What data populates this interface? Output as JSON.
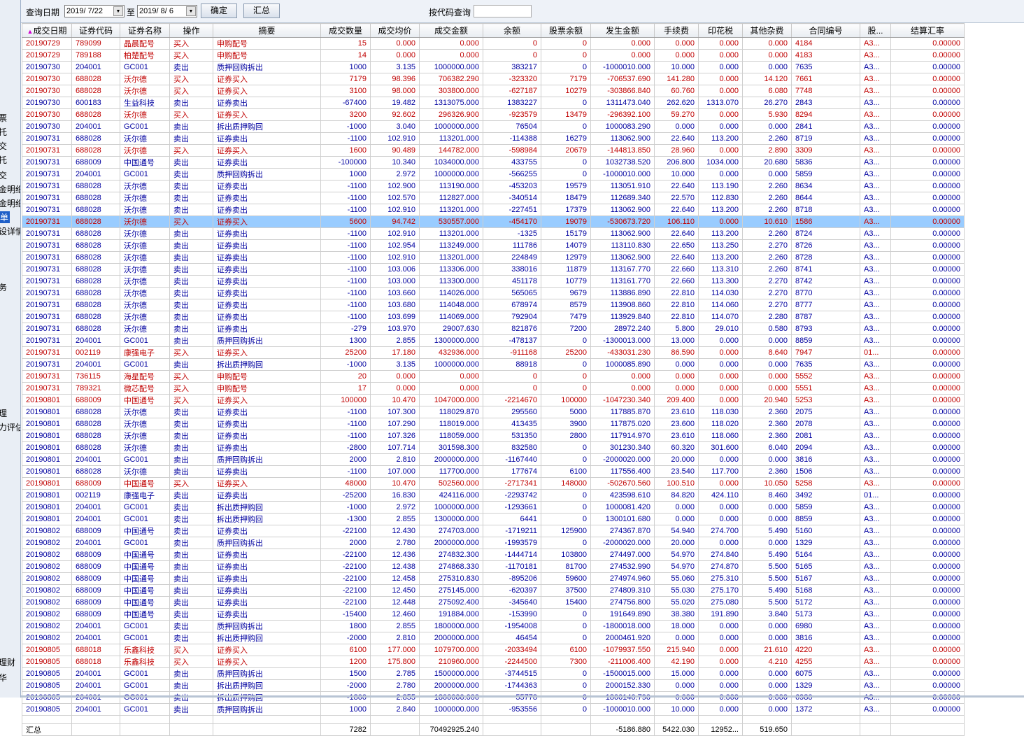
{
  "sidebar": {
    "fragments": [
      "票",
      "托",
      "交",
      "托",
      "交",
      "金明细",
      "金明细",
      "单",
      "设详情",
      "务",
      "理",
      "力评估",
      "理财",
      "华"
    ]
  },
  "toolbar": {
    "query_date_label": "查询日期",
    "date_from": "2019/ 7/22",
    "to_label": "至",
    "date_to": "2019/ 8/ 6",
    "confirm_label": "确定",
    "summary_label": "汇总",
    "code_query_label": "按代码查询",
    "code_query_value": ""
  },
  "columns": [
    "成交日期",
    "证券代码",
    "证券名称",
    "操作",
    "摘要",
    "成交数量",
    "成交均价",
    "成交金额",
    "余额",
    "股票余额",
    "发生金额",
    "手续费",
    "印花税",
    "其他杂费",
    "合同编号",
    "股...",
    "结算汇率"
  ],
  "sort_indicator": "▲",
  "selected_row": 15,
  "colors": {
    "buy": "#c00000",
    "sell": "#0000a0",
    "selected": "#99ccff"
  },
  "rows": [
    [
      "20190729",
      "789099",
      "晶晨配号",
      "买入",
      "申购配号",
      "15",
      "0.000",
      "0.000",
      "0",
      "0",
      "0.000",
      "0.000",
      "0.000",
      "0.000",
      "4184",
      "A3...",
      "0.00000"
    ],
    [
      "20190729",
      "789188",
      "柏楚配号",
      "买入",
      "申购配号",
      "14",
      "0.000",
      "0.000",
      "0",
      "0",
      "0.000",
      "0.000",
      "0.000",
      "0.000",
      "4183",
      "A3...",
      "0.00000"
    ],
    [
      "20190730",
      "204001",
      "GC001",
      "卖出",
      "质押回购拆出",
      "1000",
      "3.135",
      "1000000.000",
      "383217",
      "0",
      "-1000010.000",
      "10.000",
      "0.000",
      "0.000",
      "7635",
      "A3...",
      "0.00000"
    ],
    [
      "20190730",
      "688028",
      "沃尔德",
      "买入",
      "证券买入",
      "7179",
      "98.396",
      "706382.290",
      "-323320",
      "7179",
      "-706537.690",
      "141.280",
      "0.000",
      "14.120",
      "7661",
      "A3...",
      "0.00000"
    ],
    [
      "20190730",
      "688028",
      "沃尔德",
      "买入",
      "证券买入",
      "3100",
      "98.000",
      "303800.000",
      "-627187",
      "10279",
      "-303866.840",
      "60.760",
      "0.000",
      "6.080",
      "7748",
      "A3...",
      "0.00000"
    ],
    [
      "20190730",
      "600183",
      "生益科技",
      "卖出",
      "证券卖出",
      "-67400",
      "19.482",
      "1313075.000",
      "1383227",
      "0",
      "1311473.040",
      "262.620",
      "1313.070",
      "26.270",
      "2843",
      "A3...",
      "0.00000"
    ],
    [
      "20190730",
      "688028",
      "沃尔德",
      "买入",
      "证券买入",
      "3200",
      "92.602",
      "296326.900",
      "-923579",
      "13479",
      "-296392.100",
      "59.270",
      "0.000",
      "5.930",
      "8294",
      "A3...",
      "0.00000"
    ],
    [
      "20190730",
      "204001",
      "GC001",
      "卖出",
      "拆出质押购回",
      "-1000",
      "3.040",
      "1000000.000",
      "76504",
      "0",
      "1000083.290",
      "0.000",
      "0.000",
      "0.000",
      "2841",
      "A3...",
      "0.00000"
    ],
    [
      "20190731",
      "688028",
      "沃尔德",
      "卖出",
      "证券卖出",
      "-1100",
      "102.910",
      "113201.000",
      "-114388",
      "16279",
      "113062.900",
      "22.640",
      "113.200",
      "2.260",
      "8719",
      "A3...",
      "0.00000"
    ],
    [
      "20190731",
      "688028",
      "沃尔德",
      "买入",
      "证券买入",
      "1600",
      "90.489",
      "144782.000",
      "-598984",
      "20679",
      "-144813.850",
      "28.960",
      "0.000",
      "2.890",
      "3309",
      "A3...",
      "0.00000"
    ],
    [
      "20190731",
      "688009",
      "中国通号",
      "卖出",
      "证券卖出",
      "-100000",
      "10.340",
      "1034000.000",
      "433755",
      "0",
      "1032738.520",
      "206.800",
      "1034.000",
      "20.680",
      "5836",
      "A3...",
      "0.00000"
    ],
    [
      "20190731",
      "204001",
      "GC001",
      "卖出",
      "质押回购拆出",
      "1000",
      "2.972",
      "1000000.000",
      "-566255",
      "0",
      "-1000010.000",
      "10.000",
      "0.000",
      "0.000",
      "5859",
      "A3...",
      "0.00000"
    ],
    [
      "20190731",
      "688028",
      "沃尔德",
      "卖出",
      "证券卖出",
      "-1100",
      "102.900",
      "113190.000",
      "-453203",
      "19579",
      "113051.910",
      "22.640",
      "113.190",
      "2.260",
      "8634",
      "A3...",
      "0.00000"
    ],
    [
      "20190731",
      "688028",
      "沃尔德",
      "卖出",
      "证券卖出",
      "-1100",
      "102.570",
      "112827.000",
      "-340514",
      "18479",
      "112689.340",
      "22.570",
      "112.830",
      "2.260",
      "8644",
      "A3...",
      "0.00000"
    ],
    [
      "20190731",
      "688028",
      "沃尔德",
      "卖出",
      "证券卖出",
      "-1100",
      "102.910",
      "113201.000",
      "-227451",
      "17379",
      "113062.900",
      "22.640",
      "113.200",
      "2.260",
      "8718",
      "A3...",
      "0.00000"
    ],
    [
      "20190731",
      "688028",
      "沃尔德",
      "买入",
      "证券买入",
      "5600",
      "94.742",
      "530557.000",
      "-454170",
      "19079",
      "-530673.720",
      "106.110",
      "0.000",
      "10.610",
      "1586",
      "A3...",
      "0.00000"
    ],
    [
      "20190731",
      "688028",
      "沃尔德",
      "卖出",
      "证券卖出",
      "-1100",
      "102.910",
      "113201.000",
      "-1325",
      "15179",
      "113062.900",
      "22.640",
      "113.200",
      "2.260",
      "8724",
      "A3...",
      "0.00000"
    ],
    [
      "20190731",
      "688028",
      "沃尔德",
      "卖出",
      "证券卖出",
      "-1100",
      "102.954",
      "113249.000",
      "111786",
      "14079",
      "113110.830",
      "22.650",
      "113.250",
      "2.270",
      "8726",
      "A3...",
      "0.00000"
    ],
    [
      "20190731",
      "688028",
      "沃尔德",
      "卖出",
      "证券卖出",
      "-1100",
      "102.910",
      "113201.000",
      "224849",
      "12979",
      "113062.900",
      "22.640",
      "113.200",
      "2.260",
      "8728",
      "A3...",
      "0.00000"
    ],
    [
      "20190731",
      "688028",
      "沃尔德",
      "卖出",
      "证券卖出",
      "-1100",
      "103.006",
      "113306.000",
      "338016",
      "11879",
      "113167.770",
      "22.660",
      "113.310",
      "2.260",
      "8741",
      "A3...",
      "0.00000"
    ],
    [
      "20190731",
      "688028",
      "沃尔德",
      "卖出",
      "证券卖出",
      "-1100",
      "103.000",
      "113300.000",
      "451178",
      "10779",
      "113161.770",
      "22.660",
      "113.300",
      "2.270",
      "8742",
      "A3...",
      "0.00000"
    ],
    [
      "20190731",
      "688028",
      "沃尔德",
      "卖出",
      "证券卖出",
      "-1100",
      "103.660",
      "114026.000",
      "565065",
      "9679",
      "113886.890",
      "22.810",
      "114.030",
      "2.270",
      "8770",
      "A3...",
      "0.00000"
    ],
    [
      "20190731",
      "688028",
      "沃尔德",
      "卖出",
      "证券卖出",
      "-1100",
      "103.680",
      "114048.000",
      "678974",
      "8579",
      "113908.860",
      "22.810",
      "114.060",
      "2.270",
      "8777",
      "A3...",
      "0.00000"
    ],
    [
      "20190731",
      "688028",
      "沃尔德",
      "卖出",
      "证券卖出",
      "-1100",
      "103.699",
      "114069.000",
      "792904",
      "7479",
      "113929.840",
      "22.810",
      "114.070",
      "2.280",
      "8787",
      "A3...",
      "0.00000"
    ],
    [
      "20190731",
      "688028",
      "沃尔德",
      "卖出",
      "证券卖出",
      "-279",
      "103.970",
      "29007.630",
      "821876",
      "7200",
      "28972.240",
      "5.800",
      "29.010",
      "0.580",
      "8793",
      "A3...",
      "0.00000"
    ],
    [
      "20190731",
      "204001",
      "GC001",
      "卖出",
      "质押回购拆出",
      "1300",
      "2.855",
      "1300000.000",
      "-478137",
      "0",
      "-1300013.000",
      "13.000",
      "0.000",
      "0.000",
      "8859",
      "A3...",
      "0.00000"
    ],
    [
      "20190731",
      "002119",
      "康强电子",
      "买入",
      "证券买入",
      "25200",
      "17.180",
      "432936.000",
      "-911168",
      "25200",
      "-433031.230",
      "86.590",
      "0.000",
      "8.640",
      "7947",
      "01...",
      "0.00000"
    ],
    [
      "20190731",
      "204001",
      "GC001",
      "卖出",
      "拆出质押购回",
      "-1000",
      "3.135",
      "1000000.000",
      "88918",
      "0",
      "1000085.890",
      "0.000",
      "0.000",
      "0.000",
      "7635",
      "A3...",
      "0.00000"
    ],
    [
      "20190731",
      "736115",
      "海星配号",
      "买入",
      "申购配号",
      "20",
      "0.000",
      "0.000",
      "0",
      "0",
      "0.000",
      "0.000",
      "0.000",
      "0.000",
      "5552",
      "A3...",
      "0.00000"
    ],
    [
      "20190731",
      "789321",
      "微芯配号",
      "买入",
      "申购配号",
      "17",
      "0.000",
      "0.000",
      "0",
      "0",
      "0.000",
      "0.000",
      "0.000",
      "0.000",
      "5551",
      "A3...",
      "0.00000"
    ],
    [
      "20190801",
      "688009",
      "中国通号",
      "买入",
      "证券买入",
      "100000",
      "10.470",
      "1047000.000",
      "-2214670",
      "100000",
      "-1047230.340",
      "209.400",
      "0.000",
      "20.940",
      "5253",
      "A3...",
      "0.00000"
    ],
    [
      "20190801",
      "688028",
      "沃尔德",
      "卖出",
      "证券卖出",
      "-1100",
      "107.300",
      "118029.870",
      "295560",
      "5000",
      "117885.870",
      "23.610",
      "118.030",
      "2.360",
      "2075",
      "A3...",
      "0.00000"
    ],
    [
      "20190801",
      "688028",
      "沃尔德",
      "卖出",
      "证券卖出",
      "-1100",
      "107.290",
      "118019.000",
      "413435",
      "3900",
      "117875.020",
      "23.600",
      "118.020",
      "2.360",
      "2078",
      "A3...",
      "0.00000"
    ],
    [
      "20190801",
      "688028",
      "沃尔德",
      "卖出",
      "证券卖出",
      "-1100",
      "107.326",
      "118059.000",
      "531350",
      "2800",
      "117914.970",
      "23.610",
      "118.060",
      "2.360",
      "2081",
      "A3...",
      "0.00000"
    ],
    [
      "20190801",
      "688028",
      "沃尔德",
      "卖出",
      "证券卖出",
      "-2800",
      "107.714",
      "301598.300",
      "832580",
      "0",
      "301230.340",
      "60.320",
      "301.600",
      "6.040",
      "2094",
      "A3...",
      "0.00000"
    ],
    [
      "20190801",
      "204001",
      "GC001",
      "卖出",
      "质押回购拆出",
      "2000",
      "2.810",
      "2000000.000",
      "-1167440",
      "0",
      "-2000020.000",
      "20.000",
      "0.000",
      "0.000",
      "3816",
      "A3...",
      "0.00000"
    ],
    [
      "20190801",
      "688028",
      "沃尔德",
      "卖出",
      "证券卖出",
      "-1100",
      "107.000",
      "117700.000",
      "177674",
      "6100",
      "117556.400",
      "23.540",
      "117.700",
      "2.360",
      "1506",
      "A3...",
      "0.00000"
    ],
    [
      "20190801",
      "688009",
      "中国通号",
      "买入",
      "证券买入",
      "48000",
      "10.470",
      "502560.000",
      "-2717341",
      "148000",
      "-502670.560",
      "100.510",
      "0.000",
      "10.050",
      "5258",
      "A3...",
      "0.00000"
    ],
    [
      "20190801",
      "002119",
      "康强电子",
      "卖出",
      "证券卖出",
      "-25200",
      "16.830",
      "424116.000",
      "-2293742",
      "0",
      "423598.610",
      "84.820",
      "424.110",
      "8.460",
      "3492",
      "01...",
      "0.00000"
    ],
    [
      "20190801",
      "204001",
      "GC001",
      "卖出",
      "拆出质押购回",
      "-1000",
      "2.972",
      "1000000.000",
      "-1293661",
      "0",
      "1000081.420",
      "0.000",
      "0.000",
      "0.000",
      "5859",
      "A3...",
      "0.00000"
    ],
    [
      "20190801",
      "204001",
      "GC001",
      "卖出",
      "拆出质押购回",
      "-1300",
      "2.855",
      "1300000.000",
      "6441",
      "0",
      "1300101.680",
      "0.000",
      "0.000",
      "0.000",
      "8859",
      "A3...",
      "0.00000"
    ],
    [
      "20190802",
      "688009",
      "中国通号",
      "卖出",
      "证券卖出",
      "-22100",
      "12.430",
      "274703.000",
      "-1719211",
      "125900",
      "274367.870",
      "54.940",
      "274.700",
      "5.490",
      "5160",
      "A3...",
      "0.00000"
    ],
    [
      "20190802",
      "204001",
      "GC001",
      "卖出",
      "质押回购拆出",
      "2000",
      "2.780",
      "2000000.000",
      "-1993579",
      "0",
      "-2000020.000",
      "20.000",
      "0.000",
      "0.000",
      "1329",
      "A3...",
      "0.00000"
    ],
    [
      "20190802",
      "688009",
      "中国通号",
      "卖出",
      "证券卖出",
      "-22100",
      "12.436",
      "274832.300",
      "-1444714",
      "103800",
      "274497.000",
      "54.970",
      "274.840",
      "5.490",
      "5164",
      "A3...",
      "0.00000"
    ],
    [
      "20190802",
      "688009",
      "中国通号",
      "卖出",
      "证券卖出",
      "-22100",
      "12.438",
      "274868.330",
      "-1170181",
      "81700",
      "274532.990",
      "54.970",
      "274.870",
      "5.500",
      "5165",
      "A3...",
      "0.00000"
    ],
    [
      "20190802",
      "688009",
      "中国通号",
      "卖出",
      "证券卖出",
      "-22100",
      "12.458",
      "275310.830",
      "-895206",
      "59600",
      "274974.960",
      "55.060",
      "275.310",
      "5.500",
      "5167",
      "A3...",
      "0.00000"
    ],
    [
      "20190802",
      "688009",
      "中国通号",
      "卖出",
      "证券卖出",
      "-22100",
      "12.450",
      "275145.000",
      "-620397",
      "37500",
      "274809.310",
      "55.030",
      "275.170",
      "5.490",
      "5168",
      "A3...",
      "0.00000"
    ],
    [
      "20190802",
      "688009",
      "中国通号",
      "卖出",
      "证券卖出",
      "-22100",
      "12.448",
      "275092.400",
      "-345640",
      "15400",
      "274756.800",
      "55.020",
      "275.080",
      "5.500",
      "5172",
      "A3...",
      "0.00000"
    ],
    [
      "20190802",
      "688009",
      "中国通号",
      "卖出",
      "证券卖出",
      "-15400",
      "12.460",
      "191884.000",
      "-153990",
      "0",
      "191649.890",
      "38.380",
      "191.890",
      "3.840",
      "5173",
      "A3...",
      "0.00000"
    ],
    [
      "20190802",
      "204001",
      "GC001",
      "卖出",
      "质押回购拆出",
      "1800",
      "2.855",
      "1800000.000",
      "-1954008",
      "0",
      "-1800018.000",
      "18.000",
      "0.000",
      "0.000",
      "6980",
      "A3...",
      "0.00000"
    ],
    [
      "20190802",
      "204001",
      "GC001",
      "卖出",
      "拆出质押购回",
      "-2000",
      "2.810",
      "2000000.000",
      "46454",
      "0",
      "2000461.920",
      "0.000",
      "0.000",
      "0.000",
      "3816",
      "A3...",
      "0.00000"
    ],
    [
      "20190805",
      "688018",
      "乐鑫科技",
      "买入",
      "证券买入",
      "6100",
      "177.000",
      "1079700.000",
      "-2033494",
      "6100",
      "-1079937.550",
      "215.940",
      "0.000",
      "21.610",
      "4220",
      "A3...",
      "0.00000"
    ],
    [
      "20190805",
      "688018",
      "乐鑫科技",
      "买入",
      "证券买入",
      "1200",
      "175.800",
      "210960.000",
      "-2244500",
      "7300",
      "-211006.400",
      "42.190",
      "0.000",
      "4.210",
      "4255",
      "A3...",
      "0.00000"
    ],
    [
      "20190805",
      "204001",
      "GC001",
      "卖出",
      "质押回购拆出",
      "1500",
      "2.785",
      "1500000.000",
      "-3744515",
      "0",
      "-1500015.000",
      "15.000",
      "0.000",
      "0.000",
      "6075",
      "A3...",
      "0.00000"
    ],
    [
      "20190805",
      "204001",
      "GC001",
      "卖出",
      "拆出质押购回",
      "-2000",
      "2.780",
      "2000000.000",
      "-1744363",
      "0",
      "2000152.330",
      "0.000",
      "0.000",
      "0.000",
      "1329",
      "A3...",
      "0.00000"
    ],
    [
      "20190805",
      "204001",
      "GC001",
      "卖出",
      "拆出质押购回",
      "-1800",
      "2.855",
      "1800000.000",
      "55778",
      "0",
      "1800140.790",
      "0.000",
      "0.000",
      "0.000",
      "6980",
      "A3...",
      "0.00000"
    ],
    [
      "20190805",
      "204001",
      "GC001",
      "卖出",
      "质押回购拆出",
      "1000",
      "2.840",
      "1000000.000",
      "-953556",
      "0",
      "-1000010.000",
      "10.000",
      "0.000",
      "0.000",
      "1372",
      "A3...",
      "0.00000"
    ]
  ],
  "summary": [
    "汇总",
    "",
    "",
    "",
    "",
    "7282",
    "",
    "70492925.240",
    "",
    "",
    "-5186.880",
    "5422.030",
    "12952...",
    "519.650",
    "",
    "",
    ""
  ]
}
